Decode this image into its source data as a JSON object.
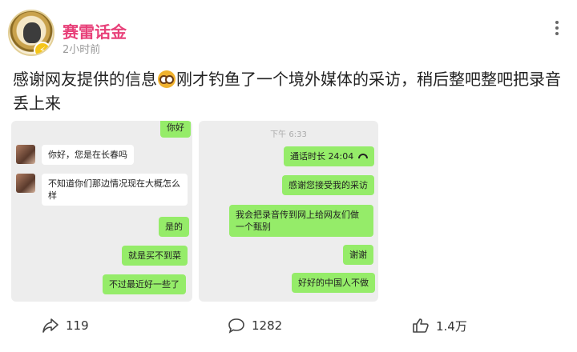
{
  "post": {
    "username": "赛雷话金",
    "time": "2小时前",
    "text_part1": "感谢网友提供的信息",
    "emoji": "owl-emoji",
    "text_part2": "刚才钓鱼了一个境外媒体的采访，稍后整吧整吧把录音丢上来"
  },
  "screenshot_left": {
    "messages": [
      {
        "text": "你好",
        "side": "right"
      },
      {
        "text": "你好，您是在长春吗",
        "side": "left"
      },
      {
        "text": "不知道你们那边情况现在大概怎么样",
        "side": "left"
      },
      {
        "text": "是的",
        "side": "right"
      },
      {
        "text": "就是买不到菜",
        "side": "right"
      },
      {
        "text": "不过最近好一些了",
        "side": "right"
      }
    ]
  },
  "screenshot_right": {
    "clock": "下午 6:33",
    "call_label": "通话时长 24:04",
    "messages": [
      {
        "text": "感谢您接受我的采访",
        "side": "right"
      },
      {
        "text": "我会把录音传到网上给网友们做一个甄别",
        "side": "right"
      },
      {
        "text": "谢谢",
        "side": "right"
      },
      {
        "text": "好好的中国人不做",
        "side": "right"
      }
    ]
  },
  "actions": {
    "share_count": "119",
    "comment_count": "1282",
    "like_count": "1.4万"
  },
  "colors": {
    "username": "#e8417a",
    "bubble_green": "#95ec69",
    "chat_bg": "#ededed"
  }
}
